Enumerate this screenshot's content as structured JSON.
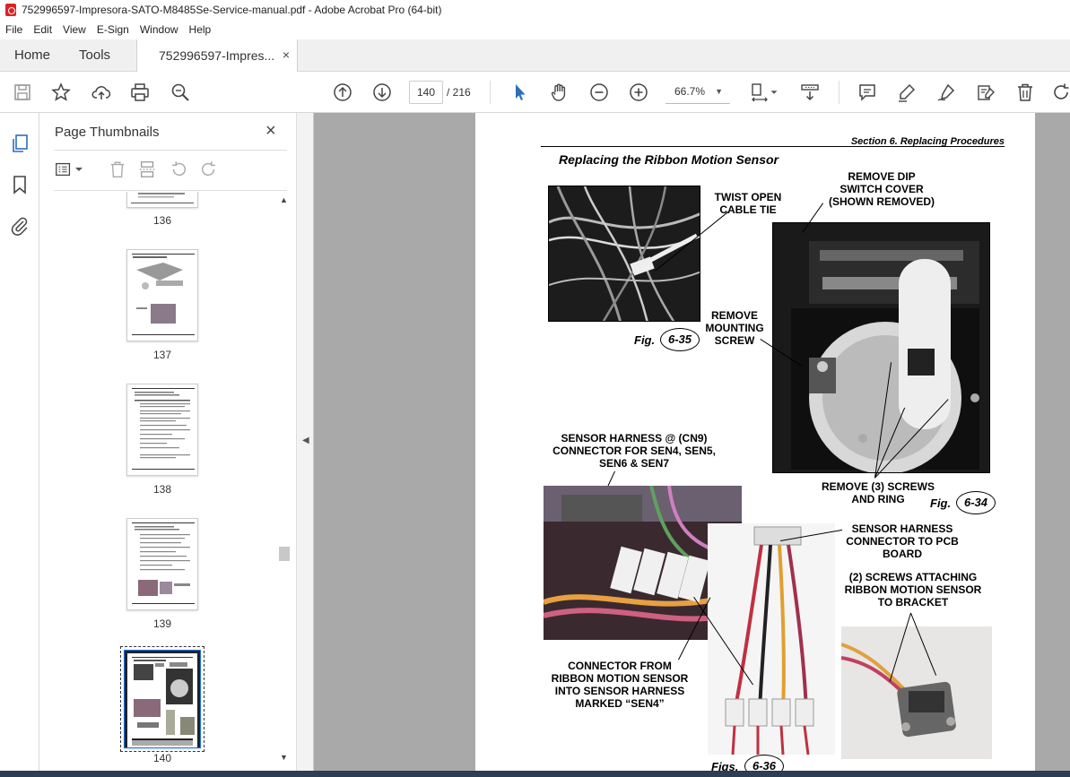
{
  "window": {
    "title": "752996597-Impresora-SATO-M8485Se-Service-manual.pdf - Adobe Acrobat Pro (64-bit)"
  },
  "menu": [
    "File",
    "Edit",
    "View",
    "E-Sign",
    "Window",
    "Help"
  ],
  "tabs": {
    "home": "Home",
    "tools": "Tools",
    "doc": "752996597-Impres...",
    "doc_close": "×"
  },
  "nav": {
    "page_current": "140",
    "page_total": "/ 216",
    "zoom": "66.7%"
  },
  "thumbnails_panel": {
    "title": "Page Thumbnails",
    "close": "×",
    "pages": [
      {
        "label": "136"
      },
      {
        "label": "137"
      },
      {
        "label": "138"
      },
      {
        "label": "139"
      },
      {
        "label": "140",
        "selected": true
      }
    ]
  },
  "document_page": {
    "section_header": "Section 6.  Replacing Procedures",
    "title": "Replacing the Ribbon Motion Sensor",
    "annotations": {
      "twist_cable": [
        "TWIST OPEN",
        "CABLE TIE"
      ],
      "remove_dip": [
        "REMOVE DIP",
        "SWITCH COVER",
        "(SHOWN REMOVED)"
      ],
      "remove_screw": [
        "REMOVE",
        "MOUNTING",
        "SCREW"
      ],
      "remove_screws_ring": [
        "REMOVE (3) SCREWS",
        "AND RING"
      ],
      "sensor_harness_cn9": [
        "SENSOR  HARNESS @ (CN9)",
        "CONNECTOR  FOR SEN4, SEN5,",
        "SEN6 & SEN7"
      ],
      "sensor_harness_pcb": [
        "SENSOR  HARNESS",
        "CONNECTOR TO PCB",
        "BOARD"
      ],
      "screws_attaching": [
        "(2) SCREWS ATTACHING",
        "RIBBON MOTION SENSOR",
        "TO BRACKET"
      ],
      "connector_from": [
        "CONNECTOR FROM",
        "RIBBON MOTION SENSOR",
        "INTO SENSOR HARNESS",
        "MARKED “SEN4”"
      ]
    },
    "figures": {
      "fig635_label": "Fig.",
      "fig635_num": "6-35",
      "fig634_label": "Fig.",
      "fig634_num": "6-34",
      "fig636_label": "Figs.",
      "fig636_num": "6-36"
    }
  },
  "colors": {
    "accent": "#2c6fbb",
    "canvas": "#a9a9a9",
    "select": "#1a73e8"
  }
}
